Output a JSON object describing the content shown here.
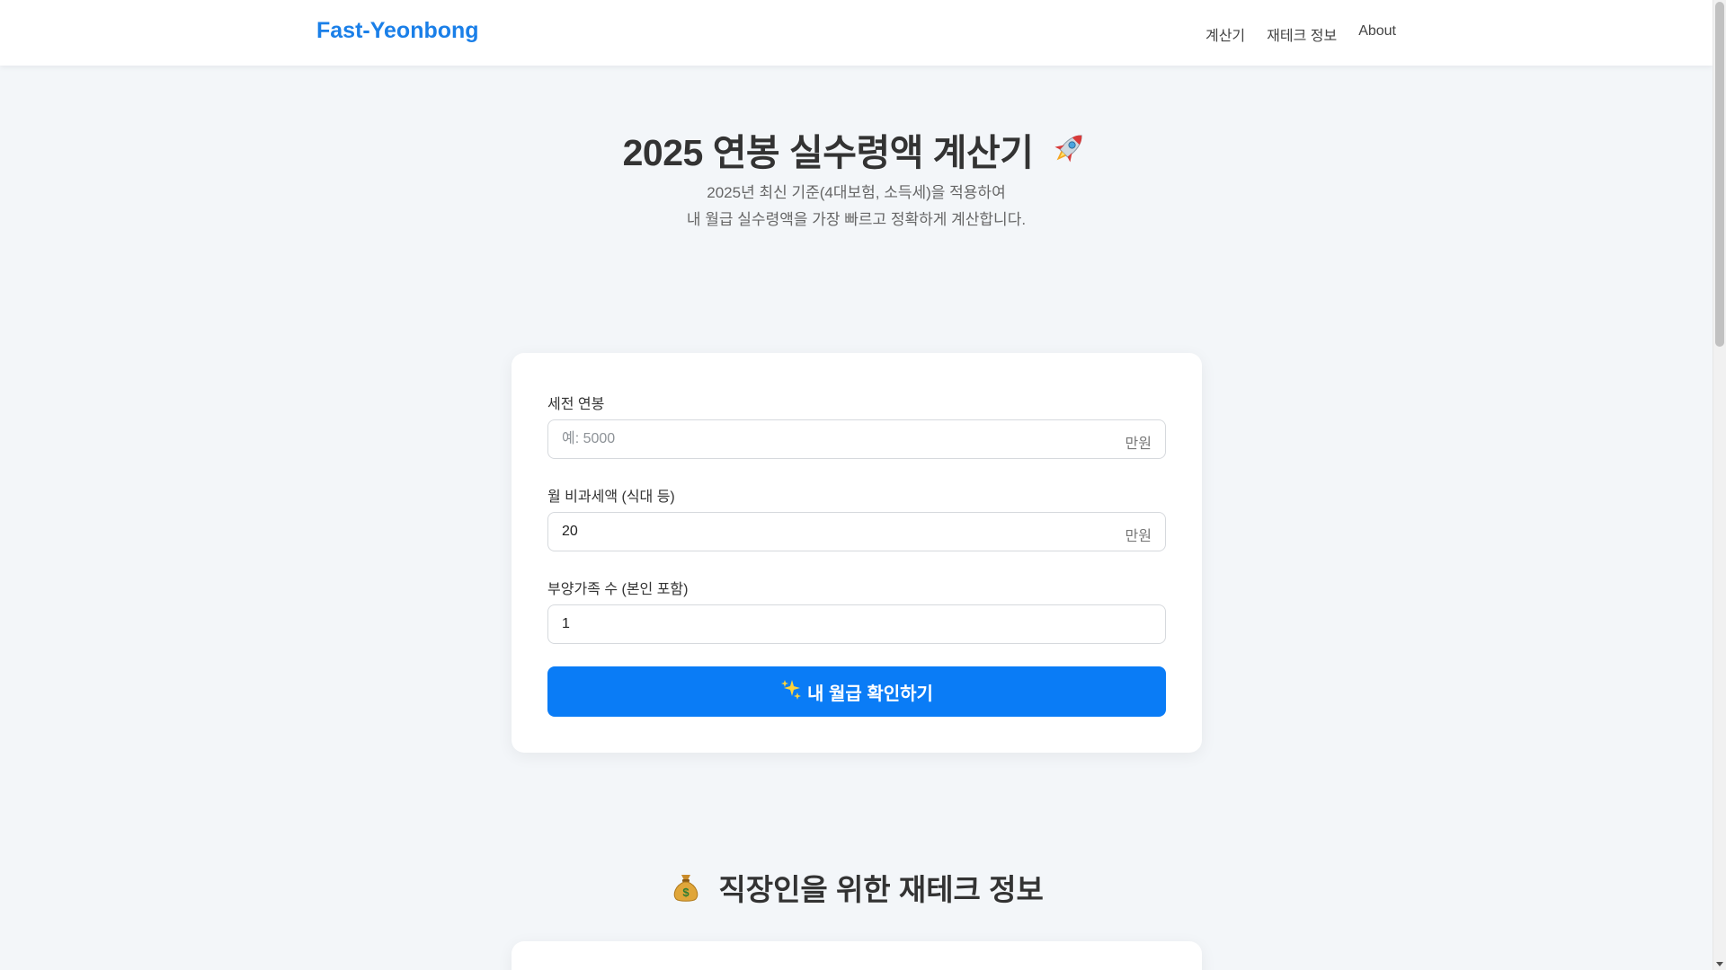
{
  "header": {
    "brand": "Fast-Yeonbong",
    "nav": [
      "계산기",
      "재테크 정보",
      "About"
    ]
  },
  "hero": {
    "title": "2025 연봉 실수령액 계산기",
    "title_icon": "rocket-icon",
    "subtitle_line1": "2025년 최신 기준(4대보험, 소득세)을 적용하여",
    "subtitle_line2": "내 월급 실수령액을 가장 빠르고 정확하게 계산합니다."
  },
  "form": {
    "salary": {
      "label": "세전 연봉",
      "placeholder": "예: 5000",
      "value": "",
      "unit": "만원"
    },
    "nontax": {
      "label": "월 비과세액 (식대 등)",
      "value": "20",
      "unit": "만원"
    },
    "dependents": {
      "label": "부양가족 수 (본인 포함)",
      "value": "1"
    },
    "submit_label": "내 월급 확인하기",
    "submit_icon": "sparkles-icon"
  },
  "section2": {
    "title": "직장인을 위한 재테크 정보",
    "title_icon": "money-bag-icon"
  },
  "colors": {
    "accent": "#0a7cf6",
    "brand": "#1a7fe8",
    "background": "#f3f6f9"
  }
}
